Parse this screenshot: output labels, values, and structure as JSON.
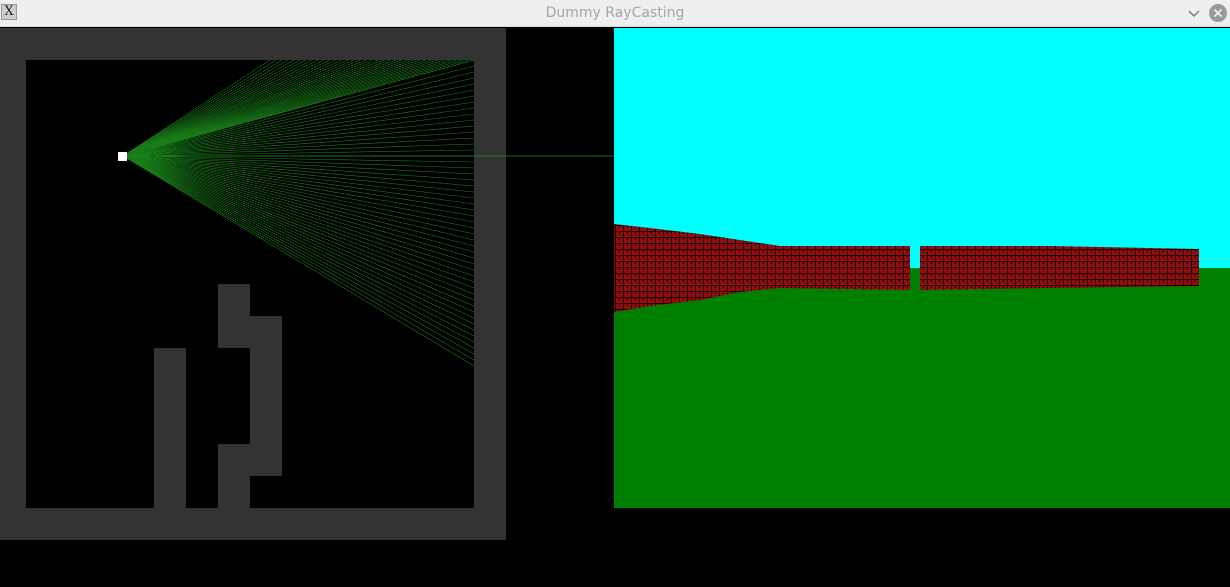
{
  "window": {
    "title": "Dummy RayCasting",
    "app_icon": "x-window-icon",
    "minimize_icon": "chevron-down-icon",
    "close_icon": "close-icon"
  },
  "colors": {
    "map_wall": "#333333",
    "map_floor": "#000000",
    "ray": "#1d8c1d",
    "player": "#ffffff",
    "sky": "#00ffff",
    "ground": "#008000",
    "brick": "#8c0e0e",
    "mortar": "#2a0000"
  }
}
